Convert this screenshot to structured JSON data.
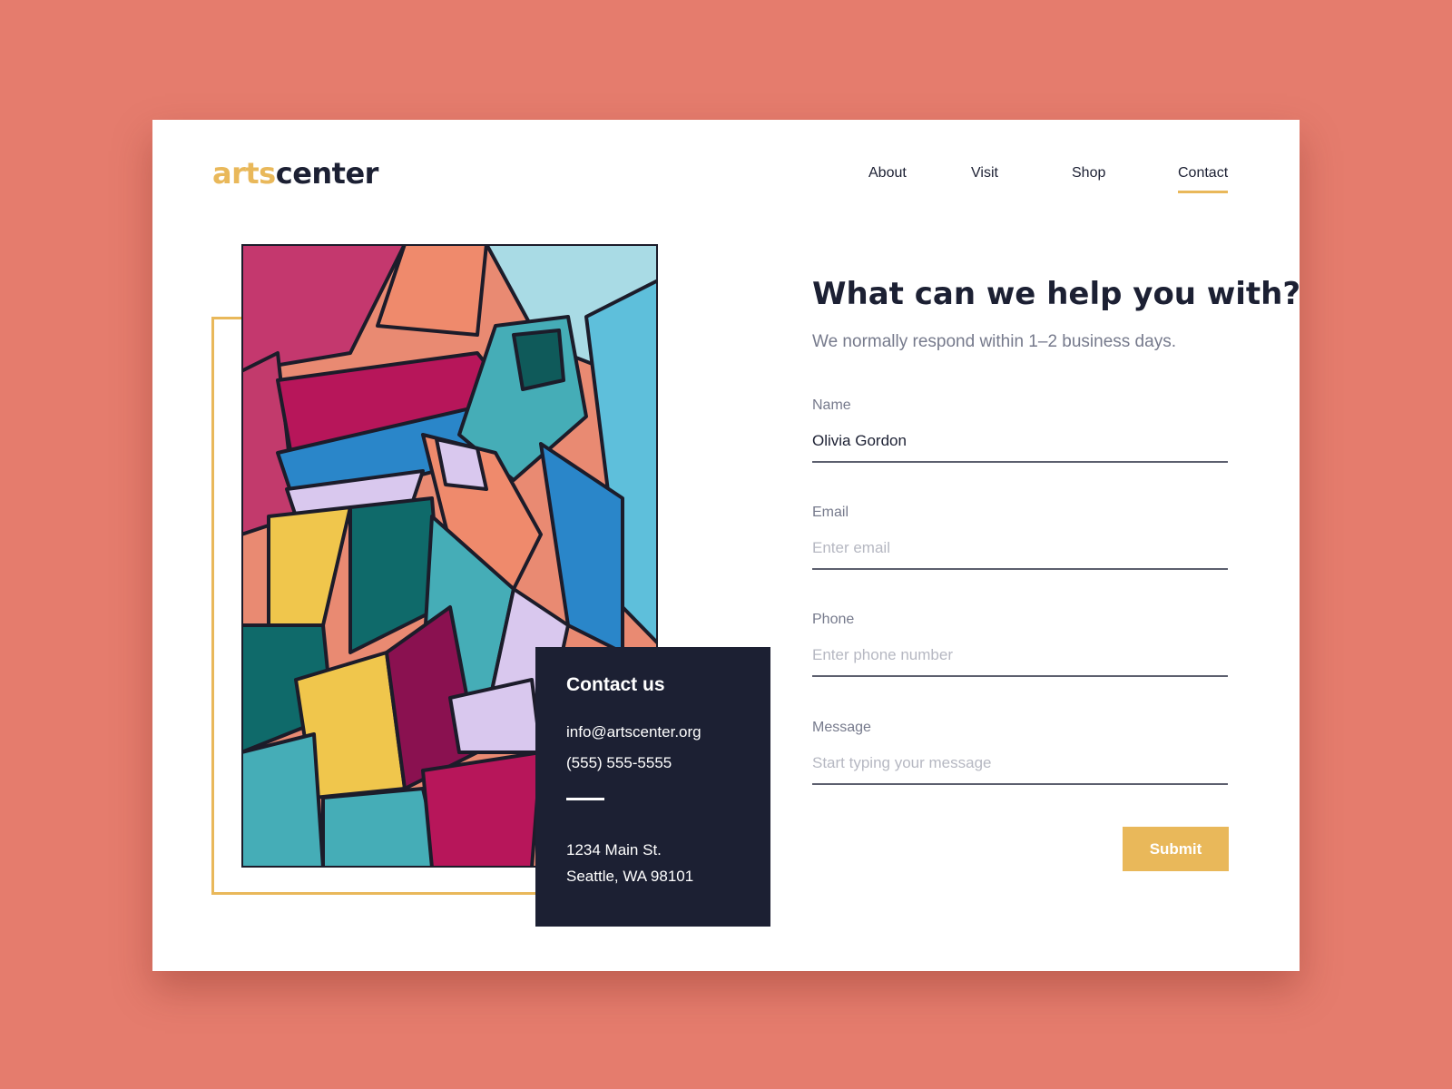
{
  "colors": {
    "background": "#e57c6d",
    "accent": "#e9b85a",
    "dark": "#1c2033"
  },
  "logo": {
    "part1": "arts",
    "part2": "center"
  },
  "nav": {
    "items": [
      {
        "label": "About"
      },
      {
        "label": "Visit"
      },
      {
        "label": "Shop"
      },
      {
        "label": "Contact",
        "active": true
      }
    ]
  },
  "contact_card": {
    "title": "Contact us",
    "email": "info@artscenter.org",
    "phone": "(555) 555-5555",
    "address_line1": "1234 Main St.",
    "address_line2": "Seattle, WA 98101"
  },
  "form": {
    "heading": "What can we help you with?",
    "subheading": "We normally respond within 1–2 business days.",
    "name": {
      "label": "Name",
      "value": "Olivia Gordon"
    },
    "email": {
      "label": "Email",
      "placeholder": "Enter email"
    },
    "phone": {
      "label": "Phone",
      "placeholder": "Enter phone number"
    },
    "message": {
      "label": "Message",
      "placeholder": "Start typing your message"
    },
    "submit_label": "Submit"
  }
}
